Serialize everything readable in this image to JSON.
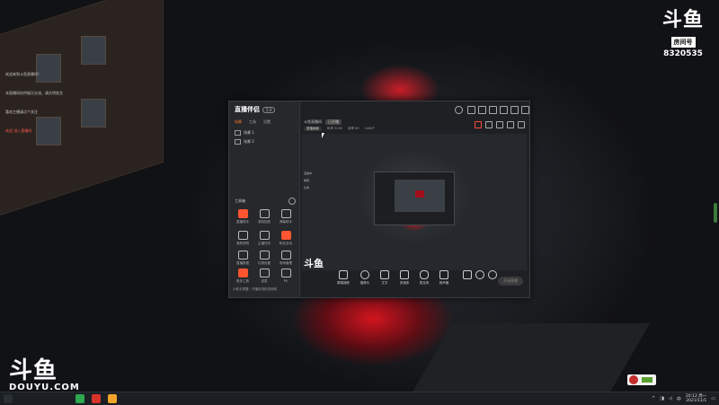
{
  "desktop": {
    "notes": [
      {
        "text": "欢迎来到斗鱼直播间！",
        "color": "#c8c8c8"
      },
      {
        "text": "本直播间仅供娱乐交流，请文明发言",
        "color": "#c8c8c8"
      },
      {
        "text": "喜欢主播请点个关注",
        "color": "#c8c8c8"
      },
      {
        "text": "欢迎  进入直播间",
        "color": "#ff5a4a"
      }
    ],
    "watermark_tr": {
      "brand": "斗鱼",
      "label": "房间号",
      "room": "8320535"
    },
    "watermark_bl": {
      "brand": "斗鱼",
      "url": "DOUYU.COM"
    }
  },
  "app": {
    "logo": "直播伴侣",
    "version": "5.0",
    "tabs": [
      {
        "label": "场景",
        "active": true
      },
      {
        "label": "工具",
        "active": false
      },
      {
        "label": "设置",
        "active": false
      }
    ],
    "scenes": [
      "场景 1",
      "场景 2"
    ],
    "tools_title": "工具箱",
    "tools": [
      {
        "label": "直播助手",
        "hot": true
      },
      {
        "label": "录制回放",
        "hot": false
      },
      {
        "label": "弹幕助手",
        "hot": false
      },
      {
        "label": "美颜滤镜",
        "hot": false
      },
      {
        "label": "主播任务",
        "hot": false
      },
      {
        "label": "粉丝互动",
        "hot": true
      },
      {
        "label": "直播数据",
        "hot": false
      },
      {
        "label": "礼物设置",
        "hot": false
      },
      {
        "label": "房间管理",
        "hot": false
      },
      {
        "label": "更多工具",
        "hot": true
      },
      {
        "label": "连麦",
        "hot": false
      },
      {
        "label": "PK",
        "hot": false
      }
    ],
    "footer": "小助手提醒：开播前请检查网络",
    "room_title": "斗鱼直播间",
    "room_chip": "已开播",
    "subbar": {
      "chip": "直播画面",
      "info_a": "码率 3000",
      "info_b": "帧率 60",
      "info_c": "1080P"
    },
    "preview_lines": [
      "直播中",
      "弹幕",
      "礼物"
    ],
    "preview_watermark": "斗鱼",
    "bottom_tools": [
      {
        "label": "屏幕捕获"
      },
      {
        "label": "摄像头"
      },
      {
        "label": "文字"
      },
      {
        "label": "多媒体"
      },
      {
        "label": "麦克风"
      },
      {
        "label": "扬声器"
      }
    ],
    "go_live": "开始直播"
  },
  "taskbar": {
    "time": "20:12 周一",
    "date": "2021/11/1",
    "lang": "中",
    "icons": [
      {
        "name": "start-icon",
        "color": "#2a2f36"
      },
      {
        "name": "browser-icon",
        "color": "#2fa84f"
      },
      {
        "name": "media-icon",
        "color": "#d8322c"
      },
      {
        "name": "douyu-app-icon",
        "color": "#f2a42a"
      }
    ]
  }
}
